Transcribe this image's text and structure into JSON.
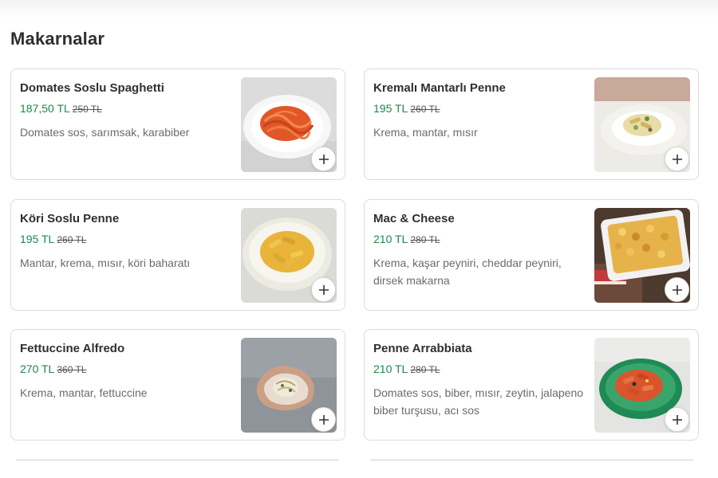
{
  "section": {
    "title": "Makarnalar"
  },
  "products": [
    {
      "name": "Domates Soslu Spaghetti",
      "price": "187,50 TL",
      "old_price": "250 TL",
      "description": "Domates sos, sarımsak, karabiber",
      "image_icon": "spaghetti-plate-icon"
    },
    {
      "name": "Kremalı Mantarlı Penne",
      "price": "195 TL",
      "old_price": "260 TL",
      "description": "Krema, mantar, mısır",
      "image_icon": "creamy-penne-plate-icon"
    },
    {
      "name": "Köri Soslu Penne",
      "price": "195 TL",
      "old_price": "260 TL",
      "description": "Mantar, krema, mısır, köri baharatı",
      "image_icon": "curry-penne-plate-icon"
    },
    {
      "name": "Mac & Cheese",
      "price": "210 TL",
      "old_price": "280 TL",
      "description": "Krema, kaşar peyniri, cheddar peyniri, dirsek makarna",
      "image_icon": "mac-cheese-tray-icon"
    },
    {
      "name": "Fettuccine Alfredo",
      "price": "270 TL",
      "old_price": "360 TL",
      "description": "Krema, mantar, fettuccine",
      "image_icon": "fettuccine-bowl-icon"
    },
    {
      "name": "Penne Arrabbiata",
      "price": "210 TL",
      "old_price": "280 TL",
      "description": "Domates sos, biber, mısır, zeytin, jalapeno biber turşusu, acı sos",
      "image_icon": "arrabbiata-bowl-icon"
    }
  ],
  "colors": {
    "price": "#1a8a4c",
    "border": "#dcdcdc",
    "title": "#2e2e2e"
  }
}
